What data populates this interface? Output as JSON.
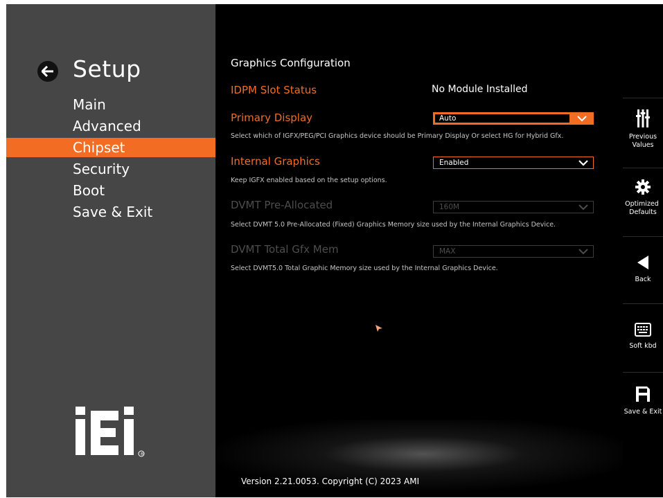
{
  "sidebar": {
    "title": "Setup",
    "back_icon": "arrow-left-icon",
    "items": [
      {
        "label": "Main",
        "active": false
      },
      {
        "label": "Advanced",
        "active": false
      },
      {
        "label": "Chipset",
        "active": true
      },
      {
        "label": "Security",
        "active": false
      },
      {
        "label": "Boot",
        "active": false
      },
      {
        "label": "Save & Exit",
        "active": false
      }
    ],
    "logo_text": "iEi",
    "logo_mark": "®"
  },
  "main": {
    "section_title": "Graphics Configuration",
    "idpm": {
      "label": "IDPM Slot Status",
      "value": "No Module Installed"
    },
    "primary_display": {
      "label": "Primary Display",
      "value": "Auto",
      "help": "Select which of IGFX/PEG/PCI Graphics device should be Primary Display Or select HG for Hybrid Gfx."
    },
    "internal_graphics": {
      "label": "Internal Graphics",
      "value": "Enabled",
      "help": "Keep IGFX enabled based on the setup options."
    },
    "dvmt_pre": {
      "label": "DVMT Pre-Allocated",
      "value": "160M",
      "help": "Select DVMT 5.0 Pre-Allocated (Fixed) Graphics Memory size used by the Internal Graphics Device."
    },
    "dvmt_total": {
      "label": "DVMT Total Gfx Mem",
      "value": "MAX",
      "help": "Select DVMT5.0 Total Graphic Memory size used by the Internal Graphics Device."
    },
    "version": "Version 2.21.0053. Copyright (C) 2023 AMI"
  },
  "actions": {
    "previous": {
      "label1": "Previous",
      "label2": "Values",
      "icon": "sliders-icon"
    },
    "optimized": {
      "label1": "Optimized",
      "label2": "Defaults",
      "icon": "gear-icon"
    },
    "back": {
      "label": "Back",
      "icon": "triangle-left-icon"
    },
    "soft_kbd": {
      "label": "Soft kbd",
      "icon": "keyboard-icon"
    },
    "save_exit": {
      "label": "Save & Exit",
      "icon": "floppy-disk-icon"
    }
  },
  "colors": {
    "accent": "#f26d23",
    "sidebar_bg": "#464646",
    "background": "#000000"
  }
}
